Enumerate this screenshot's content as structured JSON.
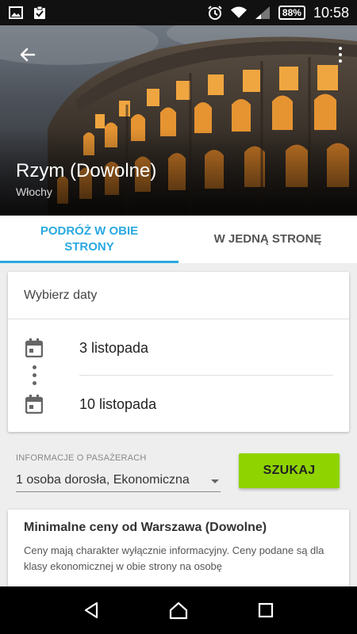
{
  "status_bar": {
    "battery": "88%",
    "time": "10:58"
  },
  "header": {
    "city": "Rzym (Dowolne)",
    "country": "Włochy"
  },
  "tabs": [
    {
      "label": "PODRÓŻ W OBIE STRONY",
      "active": true
    },
    {
      "label": "W JEDNĄ STRONĘ",
      "active": false
    }
  ],
  "dates_card": {
    "title": "Wybierz daty",
    "depart": "3 listopada",
    "return": "10 listopada"
  },
  "passengers": {
    "label": "INFORMACJE O PASAŻERACH",
    "value": "1 osoba dorosła, Ekonomiczna"
  },
  "search_button": "SZUKAJ",
  "price_card": {
    "title": "Minimalne ceny od Warszawa (Dowolne)",
    "description": "Ceny mają charakter wyłącznie informacyjny. Ceny podane są dla klasy ekonomicznej w obie strony na osobę"
  },
  "colors": {
    "accent": "#29a9e0",
    "search_button": "#8fd400"
  }
}
